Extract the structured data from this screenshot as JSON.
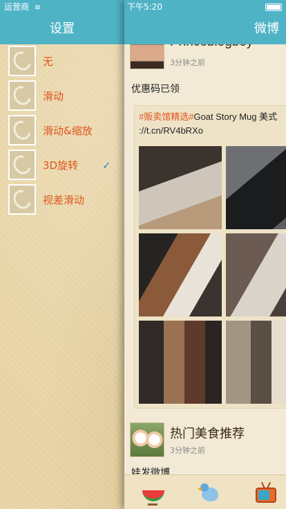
{
  "menu": {
    "status_carrier": "运营商",
    "status_wifi_icon": "wifi-icon",
    "title": "设置",
    "items": [
      {
        "label": "无",
        "selected": false
      },
      {
        "label": "滑动",
        "selected": false
      },
      {
        "label": "滑动&缩放",
        "selected": false
      },
      {
        "label": "3D旋转",
        "selected": true
      },
      {
        "label": "视差滑动",
        "selected": false
      }
    ],
    "check_mark": "✓"
  },
  "panel": {
    "status_time": "下午5:20",
    "battery_icon": "battery-icon",
    "title": "微博",
    "posts": [
      {
        "username": "Princeblogboy",
        "time": "3分钟之前",
        "text": "优惠码已领",
        "repost": {
          "hashtag": "#贩卖馆精选#",
          "text_after": "Goat Story Mug 美式",
          "link": "://t.cn/RV4bRXo"
        }
      },
      {
        "username": "热门美食推荐",
        "time": "3分钟之前"
      },
      {
        "text": "娃发微博"
      }
    ]
  },
  "tabbar": {
    "icons": [
      "watermelon-icon",
      "bird-icon",
      "tv-icon"
    ]
  },
  "colors": {
    "nav": "#4fb3c6",
    "menu_label": "#e0561c",
    "check": "#2b89e6"
  }
}
